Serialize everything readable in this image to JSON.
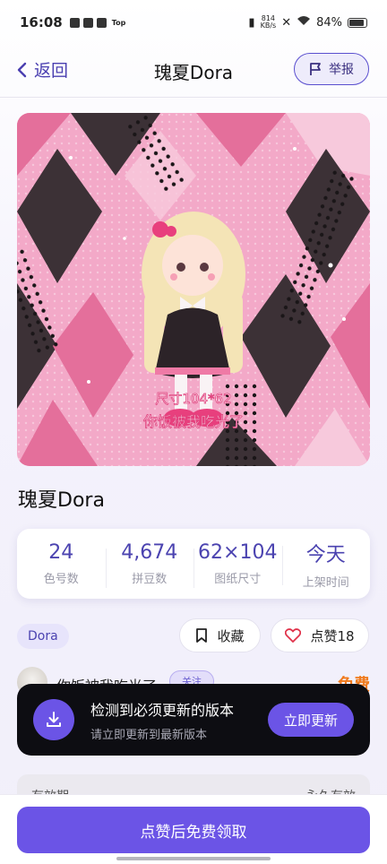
{
  "status_bar": {
    "time": "16:08",
    "app_badge": "Top",
    "net_speed_value": "814",
    "net_speed_unit": "KB/s",
    "battery_percent": "84%"
  },
  "header": {
    "back_label": "返回",
    "title": "瑰夏Dora",
    "report_label": "举报"
  },
  "artwork": {
    "caption_line1": "尺寸104*62",
    "caption_line2": "你饭被我吃光了",
    "colors": {
      "light_pink": "#f3a9c8",
      "pink": "#e46f9b",
      "dark": "#3c3136",
      "lace": "#1e1a1c"
    }
  },
  "item": {
    "title": "瑰夏Dora"
  },
  "stats": [
    {
      "value": "24",
      "label": "色号数"
    },
    {
      "value": "4,674",
      "label": "拼豆数"
    },
    {
      "value": "62×104",
      "label": "图纸尺寸"
    },
    {
      "value": "今天",
      "label": "上架时间"
    }
  ],
  "tag": "Dora",
  "actions": {
    "collect_label": "收藏",
    "like_label": "点赞18"
  },
  "author": {
    "name": "你饭被我吃光了",
    "badge": "关注",
    "price": "免费"
  },
  "toast": {
    "title": "检测到必须更新的版本",
    "subtitle": "请立即更新到最新版本",
    "button": "立即更新"
  },
  "validity": {
    "label": "有效期",
    "value": "永久有效"
  },
  "bottom": {
    "claim_label": "点赞后免费领取"
  },
  "theme": {
    "accent": "#6b54e6",
    "accent_dark": "#4b43b0",
    "price_color": "#f07a1c"
  }
}
